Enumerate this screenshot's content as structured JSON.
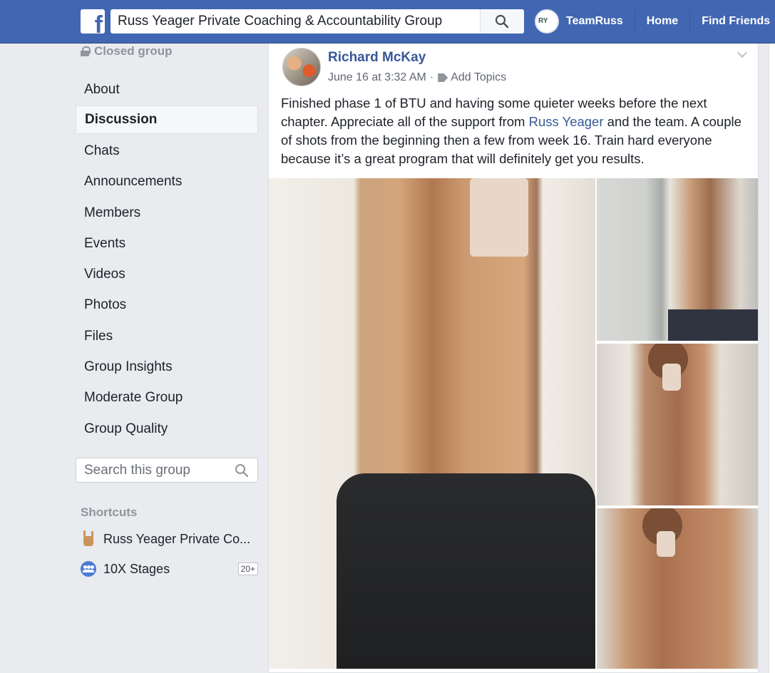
{
  "topbar": {
    "logo_letter": "f",
    "search_value": "Russ Yeager Private Coaching & Accountability Group",
    "avatar_text": "RY",
    "user_name": "TeamRuss",
    "home_label": "Home",
    "find_friends_label": "Find Friends"
  },
  "sidebar": {
    "closed_label": "Closed group",
    "items": [
      {
        "label": "About"
      },
      {
        "label": "Discussion"
      },
      {
        "label": "Chats"
      },
      {
        "label": "Announcements"
      },
      {
        "label": "Members"
      },
      {
        "label": "Events"
      },
      {
        "label": "Videos"
      },
      {
        "label": "Photos"
      },
      {
        "label": "Files"
      },
      {
        "label": "Group Insights"
      },
      {
        "label": "Moderate Group"
      },
      {
        "label": "Group Quality"
      }
    ],
    "search_placeholder": "Search this group",
    "shortcuts_title": "Shortcuts",
    "shortcuts": [
      {
        "label": "Russ Yeager Private Co...",
        "icon": "rock-hand-icon"
      },
      {
        "label": "10X Stages",
        "icon": "group-icon",
        "badge": "20+"
      }
    ]
  },
  "post": {
    "author": "Richard McKay",
    "timestamp": "June 16 at 3:32 AM",
    "separator": "·",
    "add_topics": "Add Topics",
    "text_before": "Finished phase 1 of BTU and having some quieter weeks before the next chapter. Appreciate all of the support from ",
    "mention": "Russ Yeager",
    "text_after": " and the team. A couple of shots from the beginning then a few from week 16. Train hard everyone because it’s a great program that will definitely get you results."
  },
  "colors": {
    "brand_blue": "#4267b2",
    "link_blue": "#385898",
    "page_bg": "#e9ebee"
  }
}
